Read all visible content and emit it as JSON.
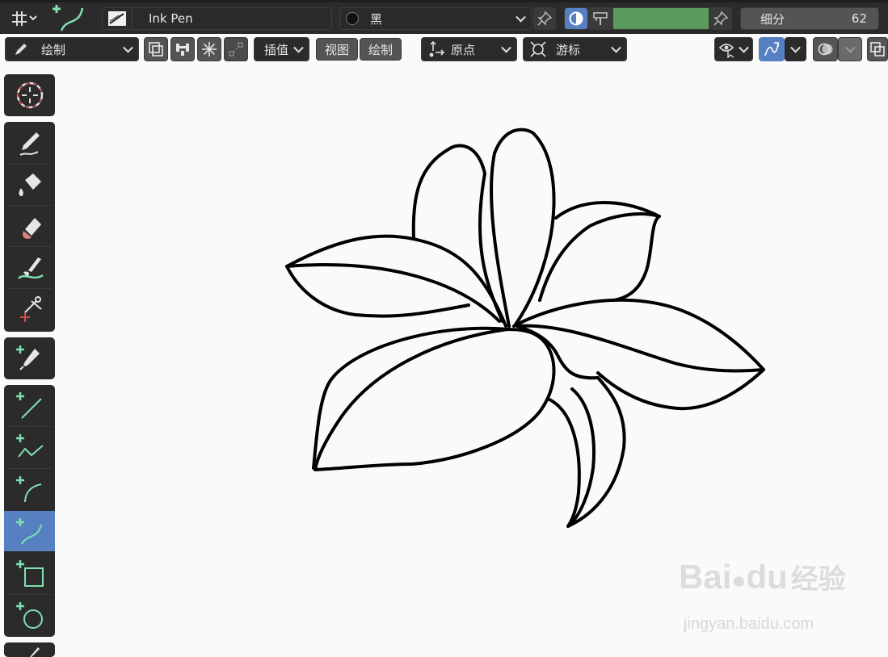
{
  "header": {
    "brush_name": "Ink Pen",
    "material_name": "黑",
    "subdivision_label": "细分",
    "subdivision_value": "62"
  },
  "toolbar": {
    "mode_label": "绘制",
    "interpolate_label": "插值",
    "view_label": "视图",
    "draw_label": "绘制",
    "origin_label": "原点",
    "cursor_label": "游标"
  },
  "colors": {
    "accent": "#5680c2",
    "strength_fill": "#5a9a5a",
    "panel": "#2b2b2b",
    "canvas": "#fafafa",
    "stroke": "#000000"
  },
  "sidebar": {
    "tools": [
      {
        "name": "cursor",
        "icon": "cursor-icon"
      },
      {
        "name": "draw",
        "icon": "pencil-icon"
      },
      {
        "name": "fill",
        "icon": "fill-bucket-icon"
      },
      {
        "name": "erase",
        "icon": "eraser-icon"
      },
      {
        "name": "tint",
        "icon": "tint-brush-icon"
      },
      {
        "name": "cutter",
        "icon": "scissors-icon"
      },
      {
        "name": "eyedropper",
        "icon": "eyedropper-icon"
      },
      {
        "name": "line",
        "icon": "line-icon"
      },
      {
        "name": "polyline",
        "icon": "polyline-icon"
      },
      {
        "name": "arc",
        "icon": "arc-icon"
      },
      {
        "name": "curve",
        "icon": "curve-icon",
        "active": true
      },
      {
        "name": "box",
        "icon": "box-icon"
      },
      {
        "name": "circle",
        "icon": "circle-icon"
      }
    ]
  },
  "watermark": {
    "brand_latin_1": "Bai",
    "brand_latin_2": "du",
    "brand_cn": "经验",
    "url": "jingyan.baidu.com"
  }
}
